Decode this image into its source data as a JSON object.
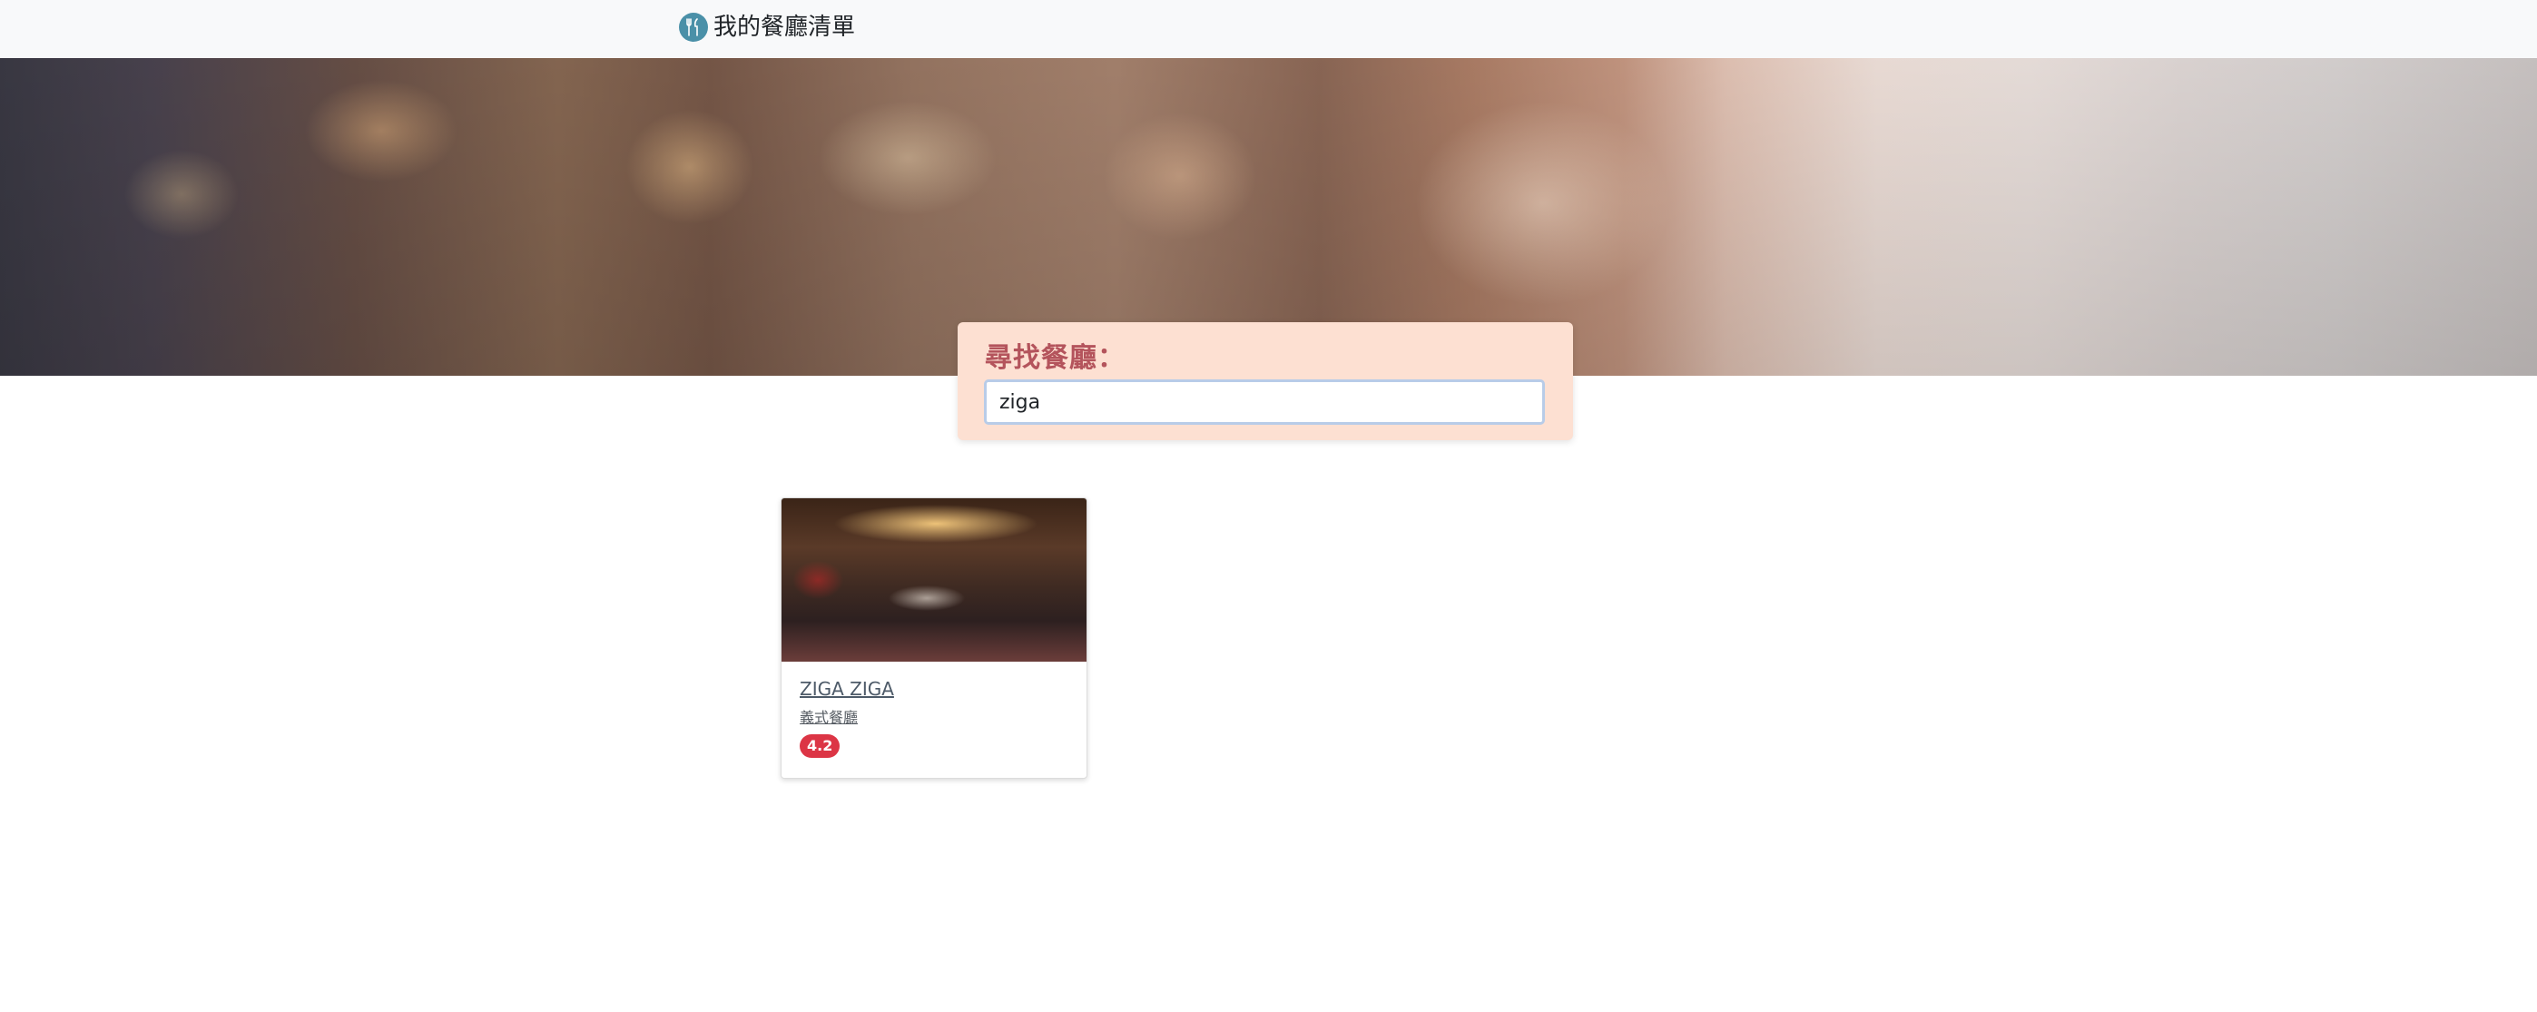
{
  "navbar": {
    "brand_text": "我的餐廳清單",
    "brand_icon": "utensils-icon"
  },
  "search": {
    "label": "尋找餐廳：",
    "value": "ziga"
  },
  "restaurants": [
    {
      "name": "ZIGA ZIGA",
      "category": "義式餐廳",
      "rating": "4.2"
    }
  ],
  "colors": {
    "search_label": "#b4545c",
    "search_box_bg": "#fde0d2",
    "rating_badge": "#dc3545",
    "brand_icon_bg": "#4a90a8"
  }
}
